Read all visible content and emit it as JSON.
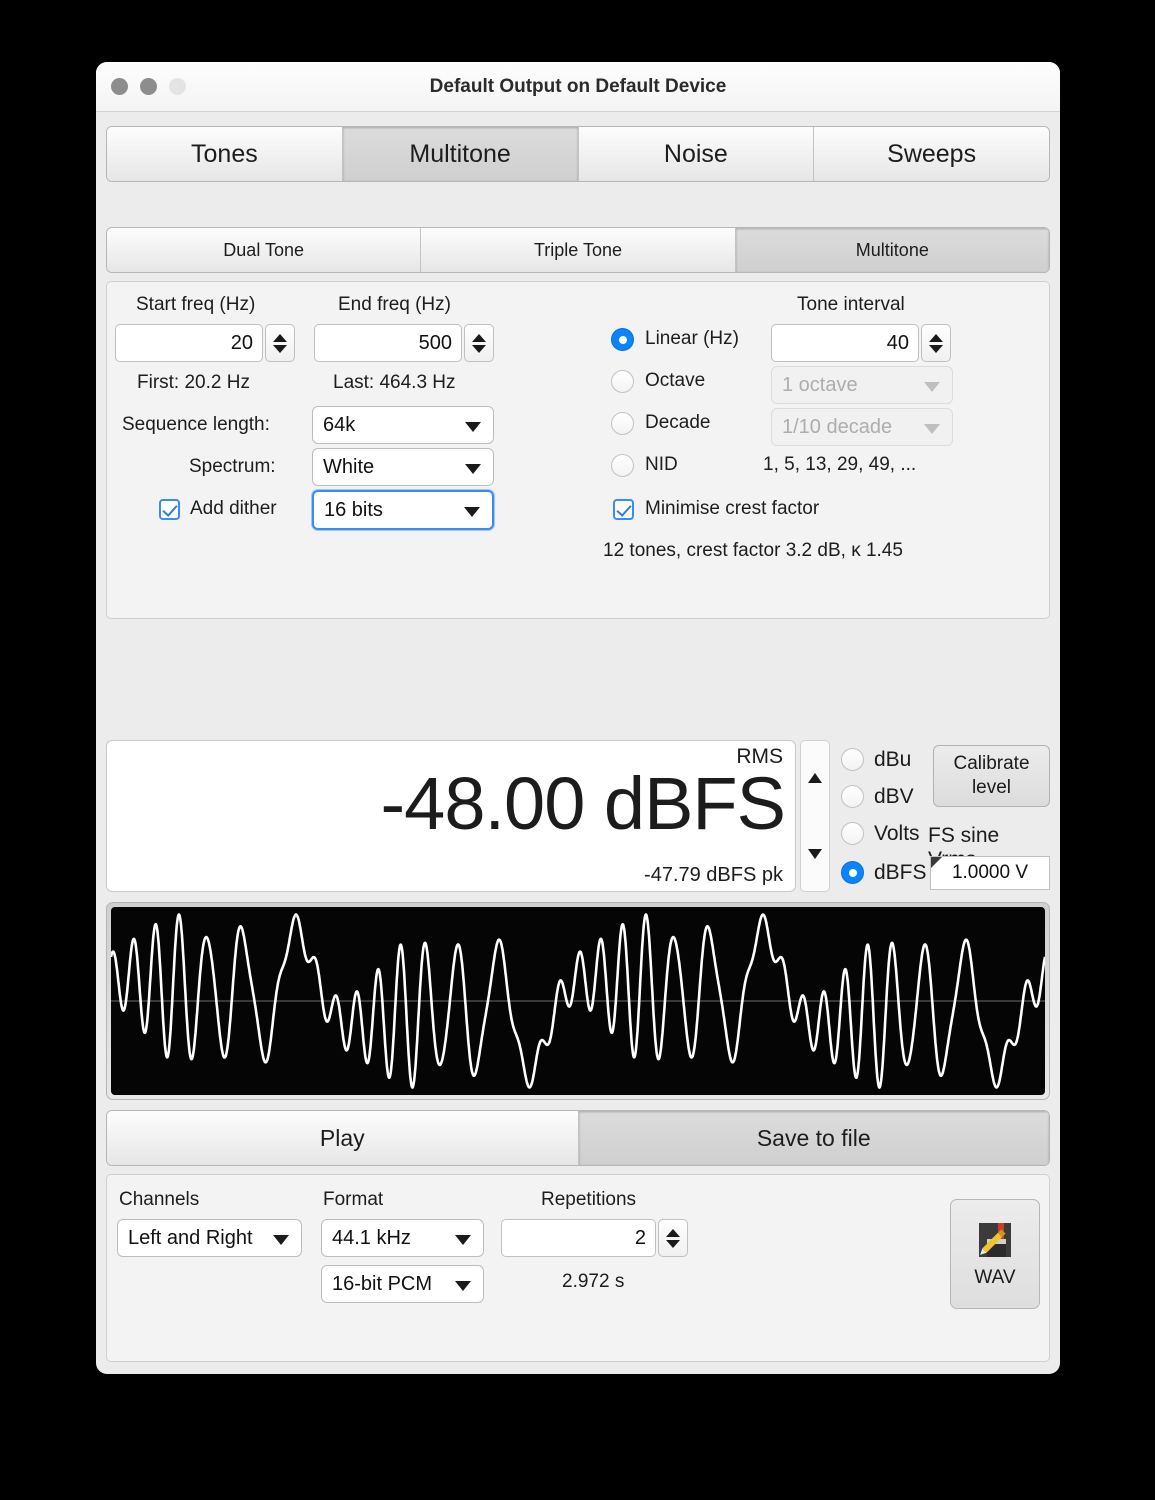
{
  "window": {
    "title": "Default Output on Default Device",
    "traffic_lights": [
      "close-button",
      "minimize-button",
      "zoom-button"
    ]
  },
  "main_tabs": [
    {
      "label": "Tones",
      "active": false
    },
    {
      "label": "Multitone",
      "active": true
    },
    {
      "label": "Noise",
      "active": false
    },
    {
      "label": "Sweeps",
      "active": false
    }
  ],
  "sub_tabs": [
    {
      "label": "Dual Tone",
      "active": false
    },
    {
      "label": "Triple Tone",
      "active": false
    },
    {
      "label": "Multitone",
      "active": true
    }
  ],
  "params": {
    "start_freq_label": "Start freq (Hz)",
    "start_freq_value": "20",
    "end_freq_label": "End freq (Hz)",
    "end_freq_value": "500",
    "first_info": "First: 20.2 Hz",
    "last_info": "Last: 464.3 Hz",
    "sequence_length_label": "Sequence length:",
    "sequence_length_value": "64k",
    "spectrum_label": "Spectrum:",
    "spectrum_value": "White",
    "add_dither_label": "Add dither",
    "add_dither_checked": true,
    "dither_bits_value": "16 bits",
    "tone_interval_label": "Tone interval",
    "interval_modes": [
      {
        "label": "Linear (Hz)",
        "selected": true
      },
      {
        "label": "Octave",
        "selected": false
      },
      {
        "label": "Decade",
        "selected": false
      },
      {
        "label": "NID",
        "selected": false
      }
    ],
    "linear_value": "40",
    "octave_value": "1 octave",
    "decade_value": "1/10 decade",
    "nid_value": "1, 5, 13, 29, 49, ...",
    "minimise_crest_label": "Minimise crest factor",
    "minimise_crest_checked": true,
    "summary": "12 tones, crest factor 3.2 dB, κ 1.45"
  },
  "level": {
    "rms_label": "RMS",
    "value": "-48.00 dBFS",
    "peak": "-47.79 dBFS pk",
    "units": [
      {
        "label": "dBu",
        "selected": false
      },
      {
        "label": "dBV",
        "selected": false
      },
      {
        "label": "Volts",
        "selected": false
      },
      {
        "label": "dBFS",
        "selected": true
      }
    ],
    "calibrate_line1": "Calibrate",
    "calibrate_line2": "level",
    "fs_sine_label": "FS sine Vrms",
    "fs_sine_value": "1.0000 V"
  },
  "transport": [
    {
      "label": "Play",
      "active": false
    },
    {
      "label": "Save to file",
      "active": true
    }
  ],
  "output": {
    "channels_label": "Channels",
    "channels_value": "Left and Right",
    "format_label": "Format",
    "sample_rate_value": "44.1 kHz",
    "bit_depth_value": "16-bit PCM",
    "repetitions_label": "Repetitions",
    "repetitions_value": "2",
    "duration": "2.972 s",
    "wav_label": "WAV",
    "wav_icon": "wav-file-icon"
  },
  "colors": {
    "accent": "#0a84ff",
    "checkbox_blue": "#3b8bf0",
    "window_bg": "#ececec",
    "scope_bg": "#050505",
    "scope_trace": "#ffffff"
  }
}
